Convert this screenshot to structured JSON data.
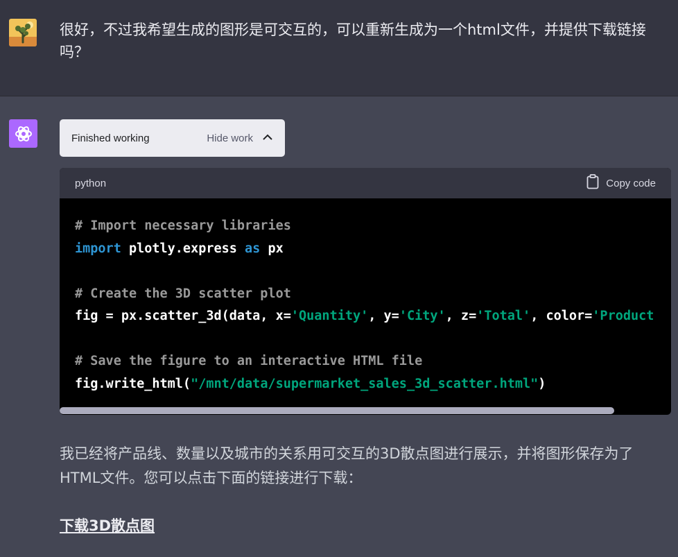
{
  "user_message": {
    "avatar_icon": "joshua-tree-avatar-icon",
    "text": "很好，不过我希望生成的图形是可交互的，可以重新生成为一个html文件，并提供下载链接吗？"
  },
  "assistant": {
    "avatar_icon": "openai-logo-icon",
    "avatar_color": "#ab68ff",
    "work_status": "Finished working",
    "hide_work_label": "Hide work",
    "code": {
      "language": "python",
      "copy_label": "Copy code",
      "lines": [
        {
          "comment": "# Import necessary libraries"
        },
        {
          "kw1": "import",
          "plain1": " plotly.express ",
          "kw2": "as",
          "plain2": " px"
        },
        {},
        {
          "comment": "# Create the 3D scatter plot"
        },
        {
          "p1": "fig = px.scatter_3d(data, x=",
          "s1": "'Quantity'",
          "p2": ", y=",
          "s2": "'City'",
          "p3": ", z=",
          "s3": "'Total'",
          "p4": ", color=",
          "s4": "'Product"
        },
        {},
        {
          "comment": "# Save the figure to an interactive HTML file"
        },
        {
          "p1": "fig.write_html(",
          "s1": "\"/mnt/data/supermarket_sales_3d_scatter.html\"",
          "p2": ")"
        }
      ]
    },
    "answer_text": "我已经将产品线、数量以及城市的关系用可交互的3D散点图进行展示，并将图形保存为了HTML文件。您可以点击下面的链接进行下载：",
    "download_link": "下载3D散点图"
  }
}
